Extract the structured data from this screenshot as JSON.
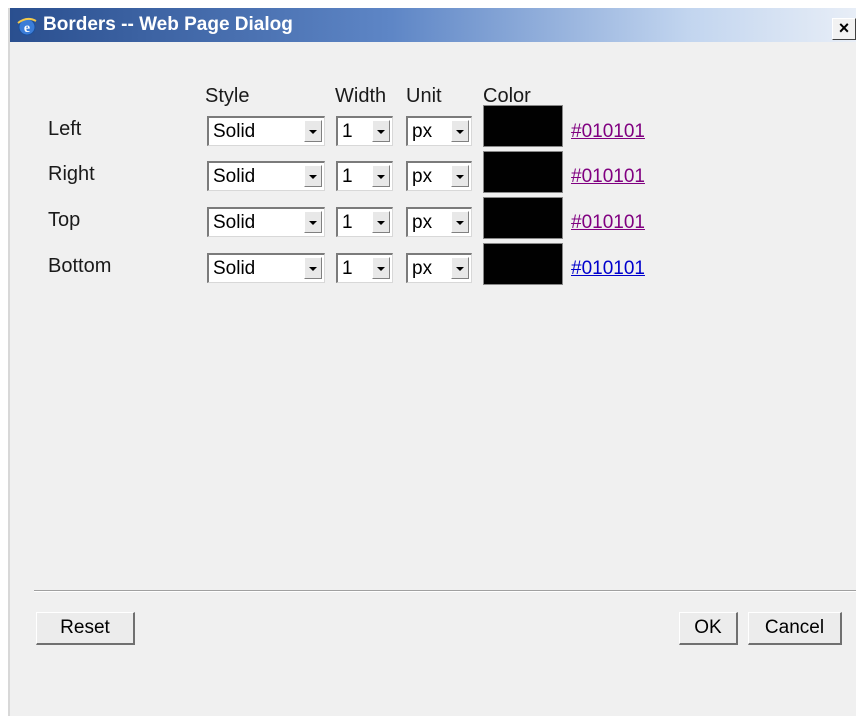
{
  "window": {
    "title": "Borders -- Web Page Dialog",
    "close_label": "×"
  },
  "columns": {
    "style": "Style",
    "width": "Width",
    "unit": "Unit",
    "color": "Color"
  },
  "rows": [
    {
      "label": "Left",
      "style": "Solid",
      "width": "1",
      "unit": "px",
      "color": "#010101",
      "link_color": "#800080"
    },
    {
      "label": "Right",
      "style": "Solid",
      "width": "1",
      "unit": "px",
      "color": "#010101",
      "link_color": "#800080"
    },
    {
      "label": "Top",
      "style": "Solid",
      "width": "1",
      "unit": "px",
      "color": "#010101",
      "link_color": "#800080"
    },
    {
      "label": "Bottom",
      "style": "Solid",
      "width": "1",
      "unit": "px",
      "color": "#010101",
      "link_color": "#0000cc"
    }
  ],
  "buttons": {
    "reset": "Reset",
    "ok": "OK",
    "cancel": "Cancel"
  },
  "icons": {
    "app": "ie-icon",
    "close": "close-icon",
    "dropdown": "chevron-down-icon"
  }
}
